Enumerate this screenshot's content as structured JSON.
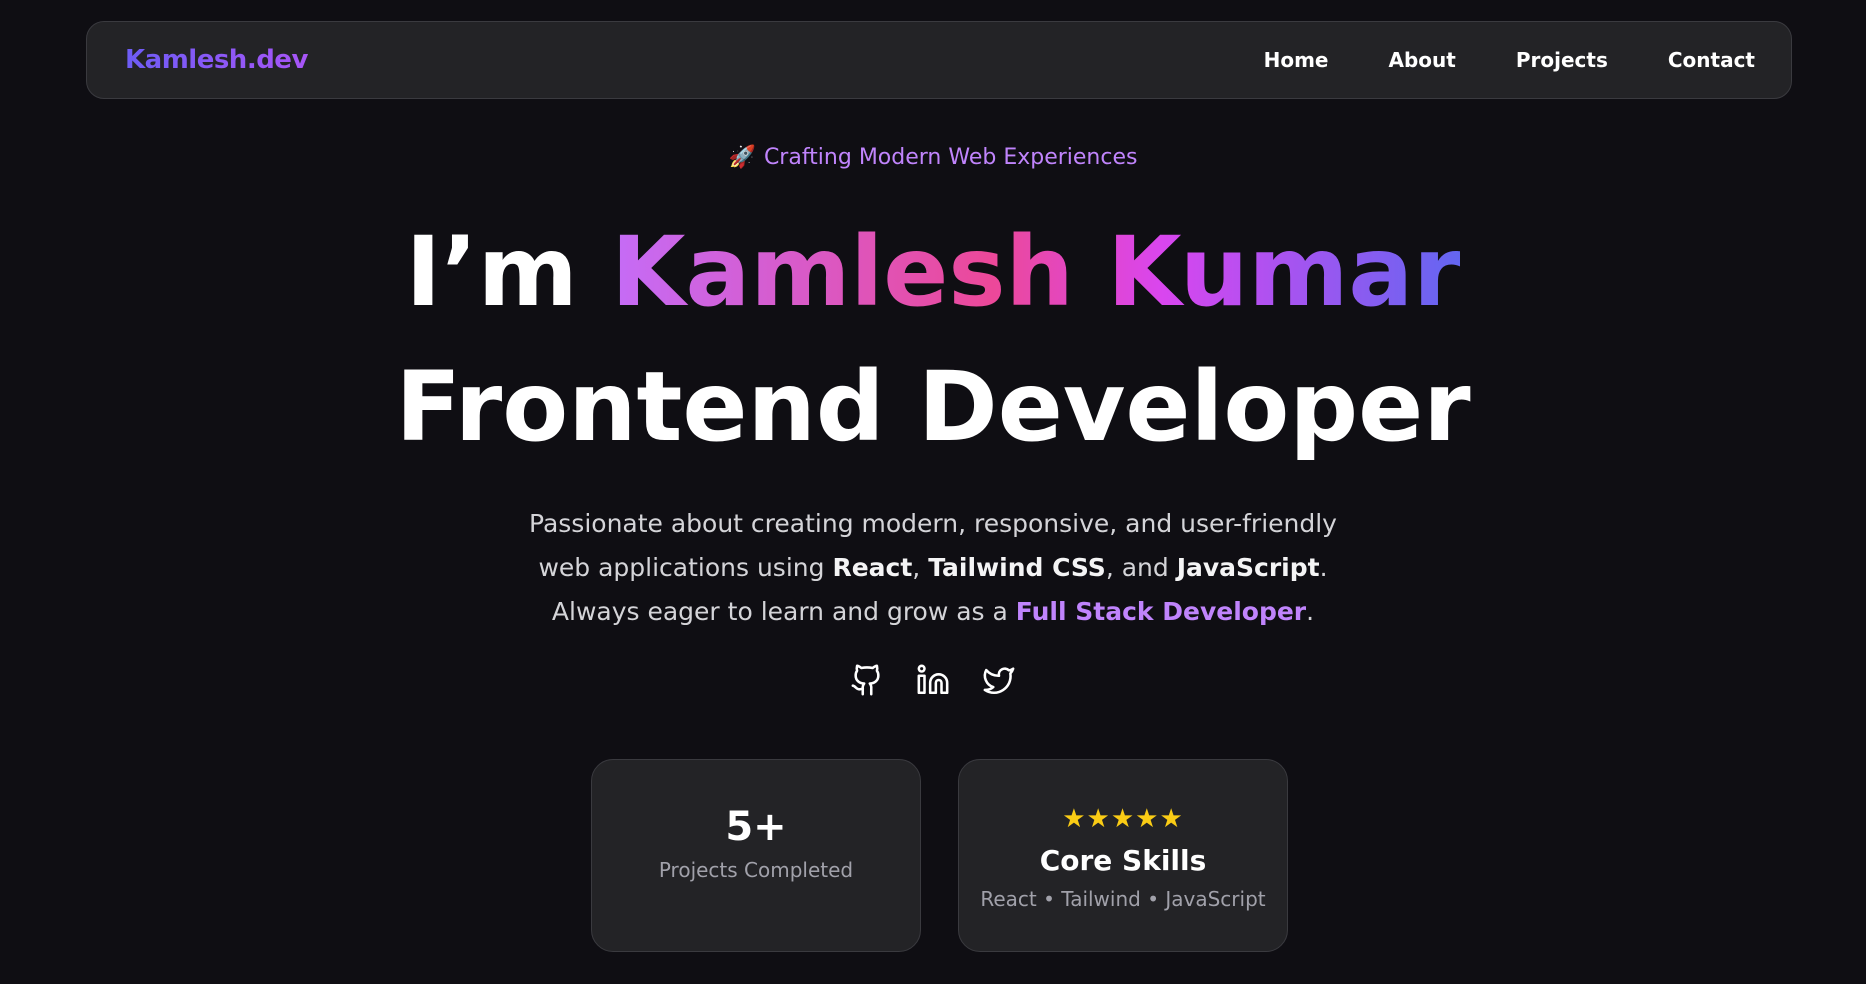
{
  "nav": {
    "brand": "Kamlesh.dev",
    "links": [
      "Home",
      "About",
      "Projects",
      "Contact"
    ]
  },
  "hero": {
    "tagline_icon": "🚀",
    "tagline": "Crafting Modern Web Experiences",
    "greeting": "I’m",
    "name": "Kamlesh Kumar",
    "role": "Frontend Developer",
    "intro": {
      "part1": "Passionate about creating modern, responsive, and user-friendly web applications using ",
      "tech1": "React",
      "sep1": ", ",
      "tech2": "Tailwind CSS",
      "sep2": ", and ",
      "tech3": "JavaScript",
      "part2": ". Always eager to learn and grow as a ",
      "goal": "Full Stack Developer",
      "part3": "."
    }
  },
  "socials": [
    {
      "icon": "github-icon"
    },
    {
      "icon": "linkedin-icon"
    },
    {
      "icon": "twitter-icon"
    }
  ],
  "stats": {
    "projects_value": "5+",
    "projects_label": "Projects Completed",
    "rating_stars": "★★★★★",
    "rating_value": 5,
    "skills_title": "Core Skills",
    "skills_list": "React • Tailwind • JavaScript"
  },
  "colors": {
    "background": "#0f0e13",
    "card": "#232326",
    "accent_purple": "#c084fc",
    "accent_pink": "#ec4899",
    "accent_indigo": "#6366f1",
    "star": "#facc15"
  }
}
